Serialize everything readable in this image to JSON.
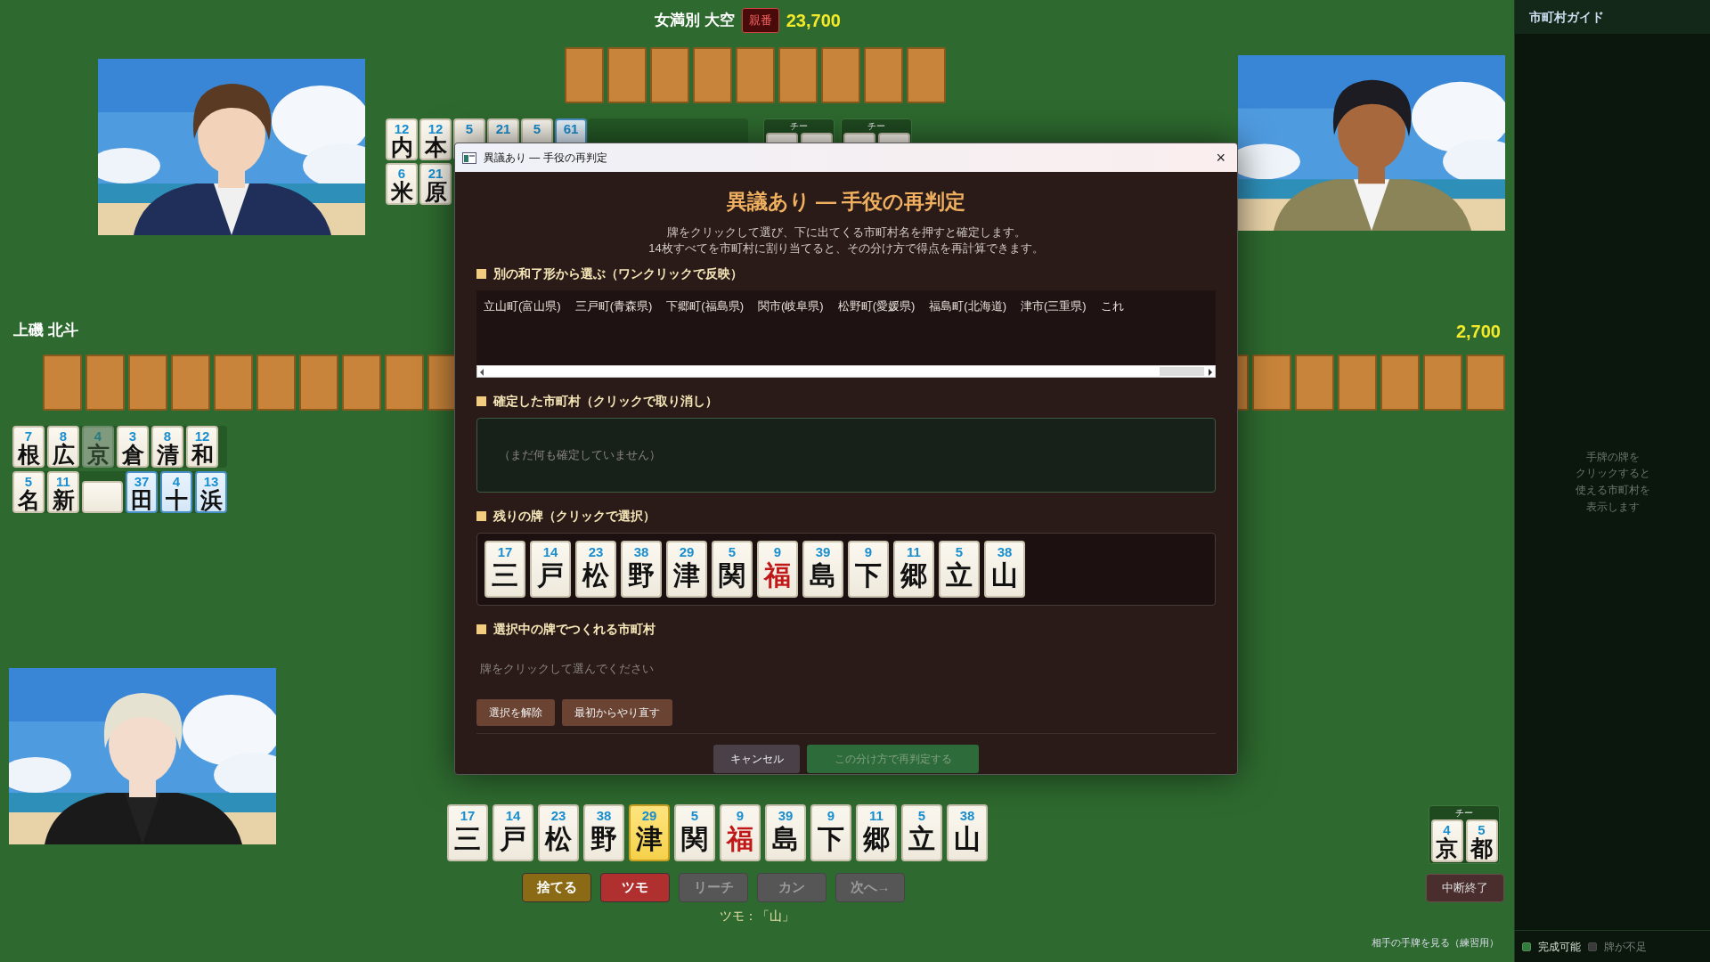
{
  "top_player": {
    "name": "女満別 大空",
    "dealer_badge": "親番",
    "score": "23,700",
    "discards": [
      [
        {
          "number": "12",
          "char": "内",
          "kind": "normal"
        },
        {
          "number": "12",
          "char": "本",
          "kind": "normal"
        },
        {
          "number": "5",
          "kind": "normal"
        },
        {
          "number": "21",
          "kind": "normal"
        },
        {
          "number": "5",
          "kind": "normal"
        },
        {
          "number": "61",
          "kind": "tinted"
        }
      ],
      [
        {
          "number": "6",
          "char": "米",
          "kind": "normal"
        },
        {
          "number": "21",
          "char": "原",
          "kind": "normal"
        }
      ]
    ],
    "melds": [
      {
        "label": "チー"
      },
      {
        "label": "チー"
      }
    ]
  },
  "left_player": {
    "name": "上磯 北斗",
    "score": "2,700",
    "discards": [
      [
        {
          "number": "7",
          "char": "根",
          "kind": "normal"
        },
        {
          "number": "8",
          "char": "広",
          "kind": "normal"
        },
        {
          "number": "4",
          "char": "京",
          "kind": "dimmed"
        },
        {
          "number": "3",
          "char": "倉",
          "kind": "normal"
        },
        {
          "number": "8",
          "char": "清",
          "kind": "normal"
        },
        {
          "number": "12",
          "char": "和",
          "kind": "normal"
        }
      ],
      [
        {
          "number": "5",
          "char": "名",
          "kind": "normal"
        },
        {
          "number": "11",
          "char": "新",
          "kind": "normal"
        },
        {
          "kind": "sideways"
        },
        {
          "number": "37",
          "char": "田",
          "kind": "tinted"
        },
        {
          "number": "4",
          "char": "十",
          "kind": "tinted"
        },
        {
          "number": "13",
          "char": "浜",
          "kind": "tinted"
        }
      ]
    ]
  },
  "player": {
    "hand": [
      {
        "number": "17",
        "char": "三",
        "selected": false
      },
      {
        "number": "14",
        "char": "戸",
        "selected": false
      },
      {
        "number": "23",
        "char": "松",
        "selected": false
      },
      {
        "number": "38",
        "char": "野",
        "selected": false
      },
      {
        "number": "29",
        "char": "津",
        "selected": true
      },
      {
        "number": "5",
        "char": "関",
        "selected": false
      },
      {
        "number": "9",
        "char": "福",
        "selected": false,
        "color": "#c01818"
      },
      {
        "number": "39",
        "char": "島",
        "selected": false
      },
      {
        "number": "9",
        "char": "下",
        "selected": false
      },
      {
        "number": "11",
        "char": "郷",
        "selected": false
      },
      {
        "number": "5",
        "char": "立",
        "selected": false
      },
      {
        "number": "38",
        "char": "山",
        "selected": false
      }
    ],
    "actions": [
      {
        "label": "捨てる",
        "kind": "discard",
        "disabled": false
      },
      {
        "label": "ツモ",
        "kind": "tsumo",
        "disabled": false
      },
      {
        "label": "リーチ",
        "kind": "plain",
        "disabled": true
      },
      {
        "label": "カン",
        "kind": "plain",
        "disabled": true
      },
      {
        "label": "次へ→",
        "kind": "plain",
        "disabled": true
      }
    ],
    "draw_note": "ツモ：「山」",
    "meld": {
      "label": "チー",
      "tiles": [
        {
          "number": "4",
          "char": "京"
        },
        {
          "number": "5",
          "char": "都"
        }
      ]
    },
    "quit_button": "中断終了",
    "peek_link": "相手の手牌を見る（練習用）"
  },
  "dialog": {
    "window_title": "異議あり — 手役の再判定",
    "close": "×",
    "heading": "異議あり — 手役の再判定",
    "description": [
      "牌をクリックして選び、下に出てくる市町村名を押すと確定します。",
      "14枚すべてを市町村に割り当てると、その分け方で得点を再計算できます。"
    ],
    "alt_section": "別の和了形から選ぶ（ワンクリックで反映）",
    "alternatives": [
      "立山町(富山県)",
      "三戸町(青森県)",
      "下郷町(福島県)",
      "関市(岐阜県)",
      "松野町(愛媛県)",
      "福島町(北海道)",
      "津市(三重県)",
      "これ"
    ],
    "confirmed_section": "確定した市町村（クリックで取り消し）",
    "confirmed_placeholder": "（まだ何も確定していません）",
    "remaining_section": "残りの牌（クリックで選択）",
    "remaining": [
      {
        "number": "17",
        "char": "三",
        "selected": false
      },
      {
        "number": "14",
        "char": "戸",
        "selected": false
      },
      {
        "number": "23",
        "char": "松",
        "selected": false
      },
      {
        "number": "38",
        "char": "野",
        "selected": false
      },
      {
        "number": "29",
        "char": "津",
        "selected": false
      },
      {
        "number": "5",
        "char": "関",
        "selected": false
      },
      {
        "number": "9",
        "char": "福",
        "selected": false,
        "color": "#c01818"
      },
      {
        "number": "39",
        "char": "島",
        "selected": false
      },
      {
        "number": "9",
        "char": "下",
        "selected": false
      },
      {
        "number": "11",
        "char": "郷",
        "selected": false
      },
      {
        "number": "5",
        "char": "立",
        "selected": false
      },
      {
        "number": "38",
        "char": "山",
        "selected": false
      }
    ],
    "candidates_section": "選択中の牌でつくれる市町村",
    "candidates_hint": "牌をクリックして選んでください",
    "tool_buttons": [
      "選択を解除",
      "最初からやり直す"
    ],
    "footer_buttons": [
      {
        "label": "キャンセル",
        "kind": "cancel",
        "disabled": false
      },
      {
        "label": "この分け方で再判定する",
        "kind": "confirm",
        "disabled": true
      }
    ]
  },
  "sidebar": {
    "title": "市町村ガイド",
    "hint": [
      "手牌の牌を",
      "クリックすると",
      "使える市町村を",
      "表示します"
    ],
    "legend": [
      {
        "label": "完成可能",
        "color": "#2e7d3a",
        "disabled": false
      },
      {
        "label": "牌が不足",
        "color": "#3a3a3a",
        "disabled": true
      }
    ]
  }
}
